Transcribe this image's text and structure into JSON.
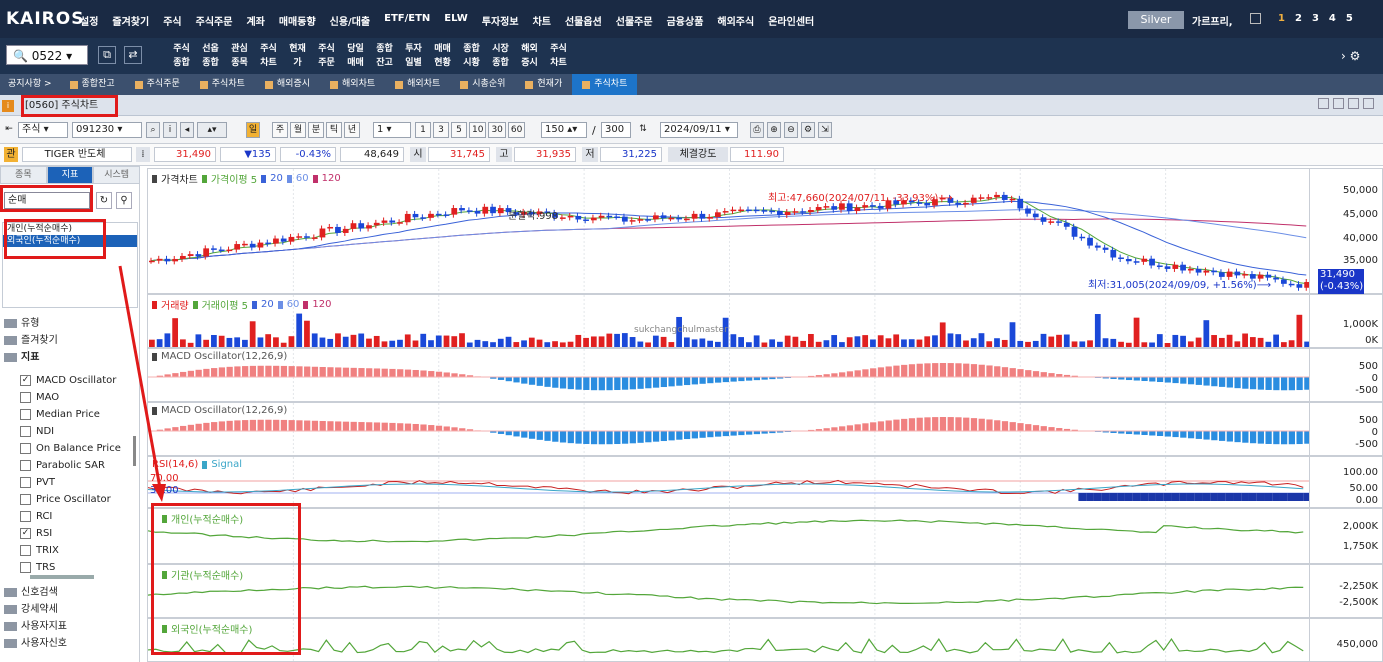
{
  "app": {
    "logo": "KAIROS",
    "menu": [
      "설정",
      "즐겨찾기",
      "주식",
      "주식주문",
      "계좌",
      "매매동향",
      "신용/대출",
      "ETF/ETN",
      "ELW",
      "투자정보",
      "차트",
      "선물옵션",
      "선물주문",
      "금융상품",
      "해외주식",
      "온라인센터"
    ],
    "grade": "Silver",
    "user": "가르프리,",
    "window_nums": [
      "1",
      "2",
      "3",
      "4",
      "5"
    ]
  },
  "toolbar": {
    "code": "0522",
    "buttons": [
      "주식\n종합",
      "선옵\n종합",
      "관심\n종목",
      "주식\n차트",
      "현재\n가",
      "주식\n주문",
      "당일\n매매",
      "종합\n잔고",
      "투자\n일별",
      "매매\n현황",
      "종합\n시황",
      "시장\n종합",
      "해외\n증시",
      "주식\n차트"
    ],
    "end": "› ⚙"
  },
  "tabs": {
    "notice": "공지사항 >",
    "items": [
      "종합잔고",
      "주식주문",
      "주식차트",
      "해외증시",
      "해외차트",
      "해외차트",
      "시총순위",
      "현재가",
      "주식차트"
    ],
    "active_index": 8
  },
  "window": {
    "title": "[0560] 주식차트"
  },
  "controls": {
    "market": "주식",
    "code": "091230",
    "period_buttons": [
      "주",
      "월",
      "분",
      "틱",
      "년"
    ],
    "minute_sel": "1",
    "minute_buttons": [
      "1",
      "3",
      "5",
      "10",
      "30",
      "60"
    ],
    "count": "150",
    "total": "300",
    "date": "2024/09/11"
  },
  "quote": {
    "name": "TIGER 반도체",
    "price": "31,490",
    "change": "▼135",
    "pct": "-0.43%",
    "volume": "48,649",
    "open_label": "시",
    "open": "31,745",
    "high_label": "고",
    "high": "31,935",
    "low_label": "저",
    "low": "31,225",
    "strength_label": "체결강도",
    "strength": "111.90"
  },
  "left": {
    "tabs": [
      "종목",
      "지표",
      "시스템"
    ],
    "active_tab": 1,
    "search": "순매",
    "results": [
      "개인(누적순매수)",
      "외국인(누적순매수)"
    ],
    "selected_result": 1,
    "categories_top": [
      "유형",
      "즐겨찾기",
      "지표"
    ],
    "indicators": [
      {
        "name": "MACD Oscillator",
        "checked": true
      },
      {
        "name": "MAO",
        "checked": false
      },
      {
        "name": "Median Price",
        "checked": false
      },
      {
        "name": "NDI",
        "checked": false
      },
      {
        "name": "On Balance Price",
        "checked": false
      },
      {
        "name": "Parabolic SAR",
        "checked": false
      },
      {
        "name": "PVT",
        "checked": false
      },
      {
        "name": "Price Oscillator",
        "checked": false
      },
      {
        "name": "RCI",
        "checked": false
      },
      {
        "name": "RSI",
        "checked": true
      },
      {
        "name": "TRIX",
        "checked": false
      },
      {
        "name": "TRS",
        "checked": false
      }
    ],
    "categories_bottom": [
      "신호검색",
      "강세약세",
      "사용자지표",
      "사용자신호"
    ]
  },
  "charts": {
    "price": {
      "legend": [
        "가격차트",
        "가격이평 5",
        "20",
        "60",
        "120"
      ],
      "axis": [
        "50,000",
        "45,000",
        "40,000",
        "35,000"
      ],
      "high_note": "최고:47,660(2024/07/11, -33.93%)⟶",
      "low_note": "최저:31,005(2024/09/09, +1.56%)⟶",
      "split_note": "분할락:998",
      "last": "31,490",
      "last_pct": "(-0.43%)"
    },
    "volume": {
      "legend": [
        "거래량",
        "거래이평 5",
        "20",
        "60",
        "120"
      ],
      "axis": [
        "1,000K",
        "0K"
      ],
      "watermark": "sukchangchulmaster"
    },
    "macd1": {
      "legend": "MACD Oscillator(12,26,9)",
      "axis": [
        "500",
        "0",
        "-500"
      ]
    },
    "macd2": {
      "legend": "MACD Oscillator(12,26,9)",
      "axis": [
        "500",
        "0",
        "-500"
      ]
    },
    "rsi": {
      "legend": "RSI(14,6)",
      "signal": "Signal",
      "level_hi": "70.00",
      "level_lo": "30.00",
      "axis": [
        "100.00",
        "50.00",
        "0.00"
      ]
    },
    "indiv": {
      "legend": "개인(누적순매수)",
      "axis": [
        "2,000K",
        "1,750K"
      ]
    },
    "inst": {
      "legend": "기관(누적순매수)",
      "axis": [
        "-2,250K",
        "-2,500K"
      ]
    },
    "foreign": {
      "legend": "외국인(누적순매수)",
      "axis": [
        "450,000"
      ]
    }
  },
  "colors": {
    "up": "#e02020",
    "down": "#1a48d8",
    "ma5": "#53a63a",
    "ma20": "#3a62d8",
    "ma60": "#6c8fe6",
    "ma120": "#c0306a",
    "annotation": "#e01a1a"
  }
}
